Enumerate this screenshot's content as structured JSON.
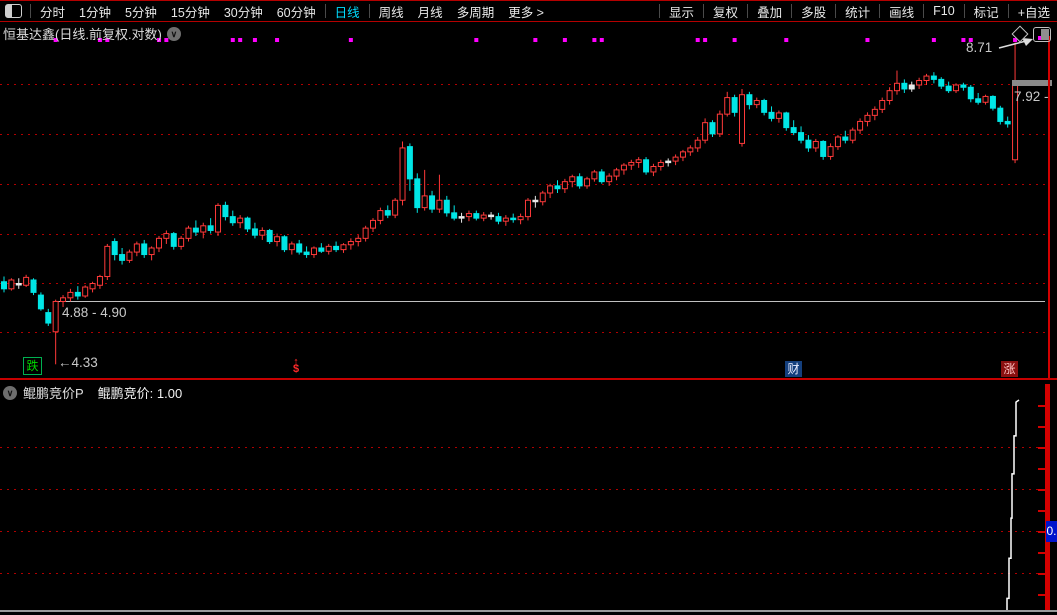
{
  "toolbar": {
    "left_items": [
      {
        "label": "分时"
      },
      {
        "label": "1分钟"
      },
      {
        "label": "5分钟"
      },
      {
        "label": "15分钟"
      },
      {
        "label": "30分钟"
      },
      {
        "label": "60分钟"
      },
      {
        "sep": true
      },
      {
        "label": "日线",
        "active": true
      },
      {
        "sep": true
      },
      {
        "label": "周线"
      },
      {
        "label": "月线"
      },
      {
        "label": "多周期"
      },
      {
        "label": "更多 >"
      }
    ],
    "right_items": [
      "显示",
      "复权",
      "叠加",
      "多股",
      "统计",
      "画线",
      "F10",
      "标记",
      "+自选"
    ]
  },
  "title": {
    "text": "恒基达鑫(日线.前复权.对数)"
  },
  "chart": {
    "labels": {
      "high": "8.71",
      "close": "7.92 -",
      "gap_range": "4.88 - 4.90",
      "low": "←4.33"
    },
    "markers": {
      "down": "跌",
      "money_arrow": "↑",
      "money": "$",
      "wealth": "财",
      "up": "涨"
    }
  },
  "indicator": {
    "name": "鲲鹏竞价P",
    "output_label": "鲲鹏竞价:",
    "output_value": "1.00",
    "axis_badge": "0."
  },
  "colors": {
    "up_candle": "#ff3a3a",
    "down_candle": "#00e6e6",
    "doji_candle": "#e8e8e8",
    "signal_dot": "#ff00ff",
    "gridline": "#b00000",
    "axis_red": "#d40000",
    "divider_red": "#c80000",
    "flat_line_gray": "#c0c0c0",
    "indicator_line": "#ffffff",
    "active_tab": "#00dcff",
    "badge_blue": "#0014cc"
  },
  "chart_data": {
    "type": "candlestick",
    "price_anchor_close": 7.92,
    "price_high": 8.71,
    "price_low": 4.33,
    "ohlc": [
      [
        5.1,
        5.16,
        4.98,
        5.02
      ],
      [
        5.02,
        5.14,
        5.0,
        5.12
      ],
      [
        5.08,
        5.14,
        5.02,
        5.08
      ],
      [
        5.06,
        5.18,
        5.04,
        5.15
      ],
      [
        5.12,
        5.14,
        4.95,
        4.98
      ],
      [
        4.95,
        4.98,
        4.78,
        4.8
      ],
      [
        4.76,
        4.8,
        4.62,
        4.65
      ],
      [
        4.56,
        4.9,
        4.24,
        4.88
      ],
      [
        4.88,
        4.95,
        4.82,
        4.92
      ],
      [
        4.92,
        5.02,
        4.88,
        4.98
      ],
      [
        4.98,
        5.05,
        4.9,
        4.94
      ],
      [
        4.94,
        5.06,
        4.92,
        5.04
      ],
      [
        5.02,
        5.1,
        4.98,
        5.08
      ],
      [
        5.06,
        5.18,
        5.02,
        5.16
      ],
      [
        5.16,
        5.55,
        5.12,
        5.52
      ],
      [
        5.58,
        5.62,
        5.35,
        5.42
      ],
      [
        5.42,
        5.5,
        5.3,
        5.35
      ],
      [
        5.35,
        5.48,
        5.32,
        5.45
      ],
      [
        5.45,
        5.58,
        5.4,
        5.55
      ],
      [
        5.55,
        5.6,
        5.38,
        5.42
      ],
      [
        5.42,
        5.52,
        5.35,
        5.5
      ],
      [
        5.5,
        5.65,
        5.45,
        5.62
      ],
      [
        5.62,
        5.72,
        5.55,
        5.68
      ],
      [
        5.68,
        5.7,
        5.48,
        5.52
      ],
      [
        5.52,
        5.65,
        5.48,
        5.62
      ],
      [
        5.62,
        5.78,
        5.58,
        5.75
      ],
      [
        5.75,
        5.85,
        5.65,
        5.7
      ],
      [
        5.7,
        5.82,
        5.62,
        5.78
      ],
      [
        5.78,
        5.88,
        5.68,
        5.72
      ],
      [
        5.7,
        6.08,
        5.65,
        6.05
      ],
      [
        6.05,
        6.1,
        5.85,
        5.9
      ],
      [
        5.9,
        5.98,
        5.78,
        5.82
      ],
      [
        5.82,
        5.92,
        5.75,
        5.88
      ],
      [
        5.88,
        5.9,
        5.7,
        5.74
      ],
      [
        5.74,
        5.82,
        5.62,
        5.66
      ],
      [
        5.66,
        5.76,
        5.6,
        5.72
      ],
      [
        5.72,
        5.74,
        5.55,
        5.58
      ],
      [
        5.58,
        5.68,
        5.52,
        5.64
      ],
      [
        5.64,
        5.66,
        5.45,
        5.48
      ],
      [
        5.48,
        5.58,
        5.42,
        5.55
      ],
      [
        5.55,
        5.6,
        5.42,
        5.45
      ],
      [
        5.45,
        5.52,
        5.38,
        5.42
      ],
      [
        5.42,
        5.52,
        5.38,
        5.5
      ],
      [
        5.5,
        5.56,
        5.44,
        5.46
      ],
      [
        5.46,
        5.55,
        5.42,
        5.52
      ],
      [
        5.52,
        5.58,
        5.45,
        5.48
      ],
      [
        5.48,
        5.56,
        5.44,
        5.54
      ],
      [
        5.54,
        5.62,
        5.48,
        5.58
      ],
      [
        5.58,
        5.66,
        5.52,
        5.62
      ],
      [
        5.62,
        5.78,
        5.58,
        5.75
      ],
      [
        5.75,
        5.88,
        5.7,
        5.85
      ],
      [
        5.85,
        6.02,
        5.8,
        5.98
      ],
      [
        5.98,
        6.05,
        5.88,
        5.92
      ],
      [
        5.92,
        6.15,
        5.88,
        6.12
      ],
      [
        6.12,
        6.98,
        6.05,
        6.88
      ],
      [
        6.9,
        6.95,
        6.25,
        6.42
      ],
      [
        6.42,
        6.5,
        5.95,
        6.02
      ],
      [
        6.02,
        6.55,
        5.98,
        6.18
      ],
      [
        6.18,
        6.25,
        5.95,
        6.0
      ],
      [
        6.0,
        6.48,
        5.95,
        6.12
      ],
      [
        6.12,
        6.18,
        5.9,
        5.95
      ],
      [
        5.95,
        6.05,
        5.85,
        5.88
      ],
      [
        5.88,
        5.95,
        5.82,
        5.9
      ],
      [
        5.9,
        5.98,
        5.84,
        5.94
      ],
      [
        5.94,
        5.98,
        5.85,
        5.88
      ],
      [
        5.88,
        5.96,
        5.84,
        5.92
      ],
      [
        5.92,
        5.96,
        5.86,
        5.9
      ],
      [
        5.9,
        5.95,
        5.8,
        5.84
      ],
      [
        5.84,
        5.92,
        5.78,
        5.88
      ],
      [
        5.88,
        5.94,
        5.82,
        5.86
      ],
      [
        5.86,
        5.94,
        5.8,
        5.9
      ],
      [
        5.9,
        6.15,
        5.85,
        6.12
      ],
      [
        6.12,
        6.18,
        6.02,
        6.1
      ],
      [
        6.1,
        6.25,
        6.05,
        6.22
      ],
      [
        6.22,
        6.35,
        6.15,
        6.32
      ],
      [
        6.32,
        6.4,
        6.22,
        6.28
      ],
      [
        6.28,
        6.42,
        6.22,
        6.38
      ],
      [
        6.38,
        6.48,
        6.3,
        6.45
      ],
      [
        6.45,
        6.5,
        6.28,
        6.32
      ],
      [
        6.32,
        6.45,
        6.28,
        6.42
      ],
      [
        6.42,
        6.55,
        6.38,
        6.52
      ],
      [
        6.52,
        6.56,
        6.35,
        6.38
      ],
      [
        6.38,
        6.5,
        6.32,
        6.46
      ],
      [
        6.46,
        6.58,
        6.4,
        6.55
      ],
      [
        6.55,
        6.65,
        6.48,
        6.62
      ],
      [
        6.62,
        6.7,
        6.55,
        6.66
      ],
      [
        6.66,
        6.74,
        6.58,
        6.7
      ],
      [
        6.7,
        6.74,
        6.48,
        6.52
      ],
      [
        6.52,
        6.64,
        6.46,
        6.6
      ],
      [
        6.6,
        6.7,
        6.54,
        6.66
      ],
      [
        6.66,
        6.72,
        6.6,
        6.68
      ],
      [
        6.68,
        6.78,
        6.62,
        6.74
      ],
      [
        6.74,
        6.85,
        6.68,
        6.82
      ],
      [
        6.82,
        6.92,
        6.76,
        6.88
      ],
      [
        6.88,
        7.05,
        6.82,
        7.0
      ],
      [
        7.0,
        7.35,
        6.95,
        7.28
      ],
      [
        7.28,
        7.32,
        7.05,
        7.1
      ],
      [
        7.1,
        7.48,
        7.05,
        7.42
      ],
      [
        7.42,
        7.8,
        7.38,
        7.7
      ],
      [
        7.7,
        7.75,
        7.38,
        7.45
      ],
      [
        6.95,
        7.85,
        6.9,
        7.75
      ],
      [
        7.75,
        7.8,
        7.5,
        7.58
      ],
      [
        7.58,
        7.7,
        7.52,
        7.65
      ],
      [
        7.65,
        7.68,
        7.4,
        7.45
      ],
      [
        7.45,
        7.55,
        7.3,
        7.35
      ],
      [
        7.35,
        7.48,
        7.28,
        7.44
      ],
      [
        7.44,
        7.46,
        7.15,
        7.2
      ],
      [
        7.2,
        7.32,
        7.08,
        7.12
      ],
      [
        7.12,
        7.22,
        6.95,
        7.0
      ],
      [
        7.0,
        7.08,
        6.82,
        6.88
      ],
      [
        6.88,
        7.02,
        6.82,
        6.98
      ],
      [
        6.98,
        7.0,
        6.7,
        6.75
      ],
      [
        6.75,
        6.95,
        6.7,
        6.9
      ],
      [
        6.9,
        7.08,
        6.85,
        7.05
      ],
      [
        7.05,
        7.15,
        6.95,
        7.0
      ],
      [
        7.0,
        7.2,
        6.95,
        7.16
      ],
      [
        7.16,
        7.35,
        7.1,
        7.3
      ],
      [
        7.3,
        7.45,
        7.22,
        7.4
      ],
      [
        7.4,
        7.55,
        7.32,
        7.5
      ],
      [
        7.5,
        7.7,
        7.44,
        7.65
      ],
      [
        7.65,
        7.88,
        7.58,
        7.82
      ],
      [
        7.82,
        8.18,
        7.75,
        7.95
      ],
      [
        7.95,
        8.02,
        7.78,
        7.85
      ],
      [
        7.85,
        7.98,
        7.8,
        7.92
      ],
      [
        7.92,
        8.05,
        7.85,
        8.0
      ],
      [
        8.0,
        8.12,
        7.92,
        8.08
      ],
      [
        8.08,
        8.15,
        7.95,
        8.02
      ],
      [
        8.02,
        8.06,
        7.85,
        7.9
      ],
      [
        7.9,
        7.98,
        7.78,
        7.82
      ],
      [
        7.82,
        7.95,
        7.78,
        7.92
      ],
      [
        7.92,
        7.96,
        7.82,
        7.88
      ],
      [
        7.88,
        7.92,
        7.62,
        7.68
      ],
      [
        7.68,
        7.78,
        7.58,
        7.62
      ],
      [
        7.62,
        7.75,
        7.58,
        7.72
      ],
      [
        7.72,
        7.74,
        7.48,
        7.52
      ],
      [
        7.52,
        7.56,
        7.25,
        7.3
      ],
      [
        7.3,
        7.38,
        7.2,
        7.26
      ],
      [
        6.7,
        8.71,
        6.65,
        7.92
      ]
    ],
    "white_doji_indices": [
      2,
      62,
      66,
      72,
      90,
      123
    ],
    "signal_dot_bars": [
      7,
      13,
      14,
      21,
      22,
      31,
      32,
      34,
      37,
      47,
      64,
      72,
      76,
      80,
      81,
      94,
      95,
      99,
      106,
      117,
      126,
      130,
      131,
      137
    ],
    "indicator_step_line": {
      "type": "step-line",
      "value_range": [
        0,
        1.0
      ],
      "points_x_value": [
        [
          0,
          0
        ],
        [
          1007,
          0
        ],
        [
          1007,
          0.06
        ],
        [
          1009,
          0.06
        ],
        [
          1009,
          0.25
        ],
        [
          1011,
          0.25
        ],
        [
          1011,
          0.44
        ],
        [
          1012,
          0.44
        ],
        [
          1012,
          0.65
        ],
        [
          1014,
          0.65
        ],
        [
          1014,
          0.83
        ],
        [
          1016,
          0.83
        ],
        [
          1016,
          0.99
        ],
        [
          1019,
          1.0
        ]
      ]
    }
  }
}
